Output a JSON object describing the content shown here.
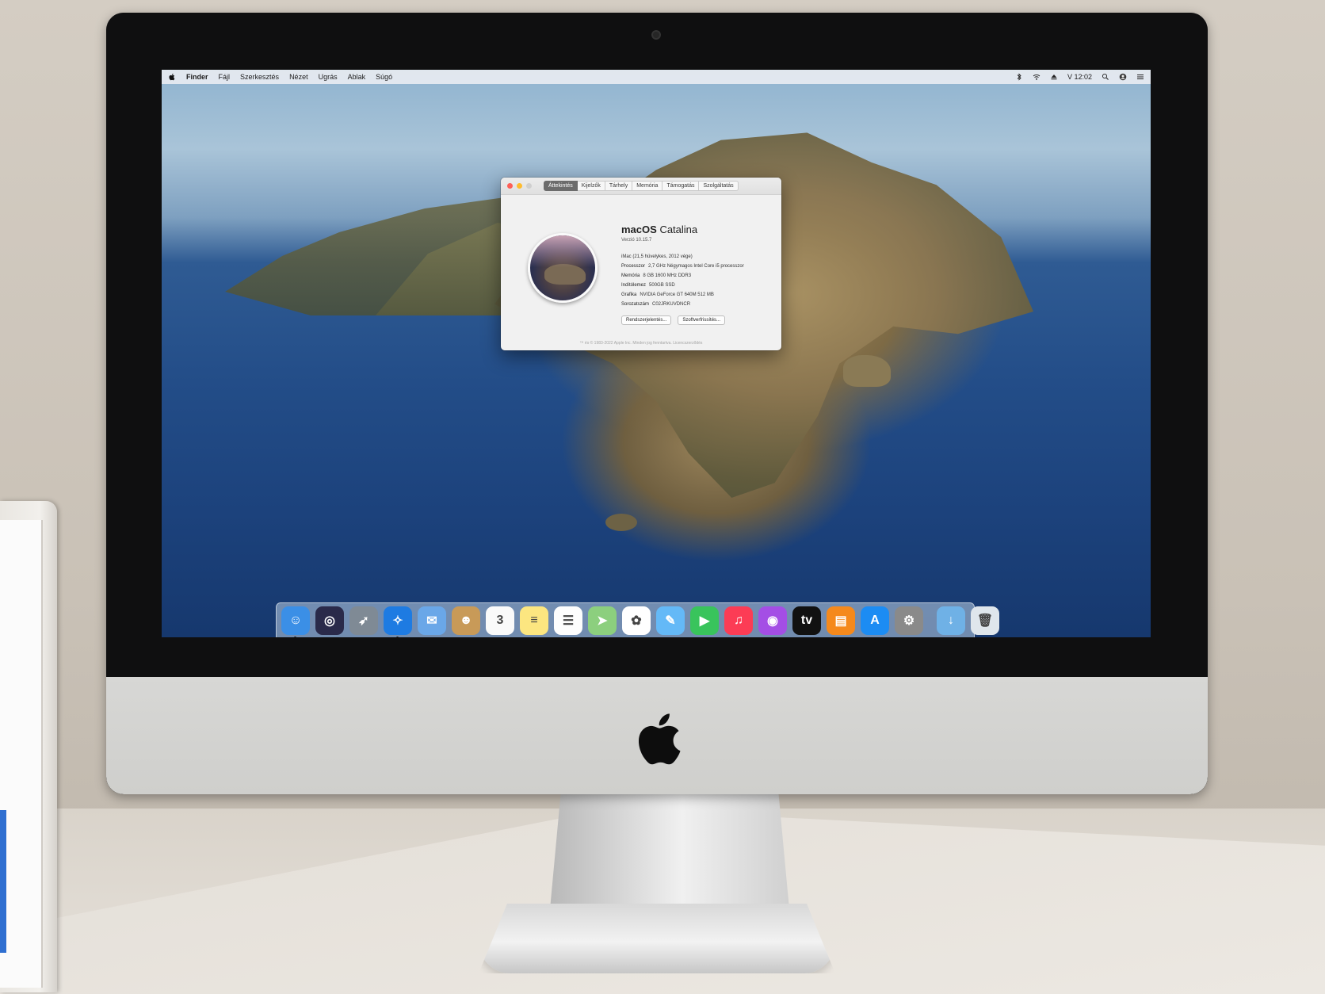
{
  "menubar": {
    "app_name": "Finder",
    "items": [
      "Fájl",
      "Szerkesztés",
      "Nézet",
      "Ugrás",
      "Ablak",
      "Súgó"
    ],
    "clock": "V 12:02",
    "icons": [
      "apple-icon",
      "bluetooth-icon",
      "wifi-icon",
      "eject-icon",
      "spotlight-search-icon",
      "user-icon",
      "notification-center-icon"
    ]
  },
  "about_window": {
    "tabs": [
      "Áttekintés",
      "Kijelzők",
      "Tárhely",
      "Memória",
      "Támogatás",
      "Szolgáltatás"
    ],
    "active_tab": "Áttekintés",
    "os_name_bold": "macOS",
    "os_name_light": "Catalina",
    "version": "Verzió 10.15.7",
    "model": "iMac (21,5 hüvelykes, 2012 vége)",
    "specs": [
      {
        "label": "Processzor",
        "value": "2,7 GHz Négymagos Intel Core i5 processzor"
      },
      {
        "label": "Memória",
        "value": "8 GB 1600 MHz DDR3"
      },
      {
        "label": "Indítólemez",
        "value": "500GB SSD"
      },
      {
        "label": "Grafika",
        "value": "NVIDIA GeForce GT 640M 512 MB"
      },
      {
        "label": "Sorozatszám",
        "value": "C02JRKUVDNCR"
      }
    ],
    "buttons": [
      "Rendszerjelentés...",
      "Szoftverfrissítés..."
    ],
    "footer": "™ és © 1983-2022 Apple Inc. Minden jog fenntartva. Licencszerződés"
  },
  "dock": {
    "apps": [
      {
        "name": "finder-icon",
        "color": "#3b8fe6",
        "glyph": "☺",
        "running": true
      },
      {
        "name": "siri-icon",
        "color": "#2a2a4a",
        "glyph": "◎",
        "running": false
      },
      {
        "name": "launchpad-icon",
        "color": "#7f8a95",
        "glyph": "➶",
        "running": false
      },
      {
        "name": "safari-icon",
        "color": "#1e7be2",
        "glyph": "✧",
        "running": true
      },
      {
        "name": "mail-icon",
        "color": "#6aa7e8",
        "glyph": "✉",
        "running": false
      },
      {
        "name": "contacts-icon",
        "color": "#c89a58",
        "glyph": "☻",
        "running": false
      },
      {
        "name": "calendar-icon",
        "color": "#fafafa",
        "glyph": "3",
        "running": false
      },
      {
        "name": "notes-icon",
        "color": "#fce680",
        "glyph": "≡",
        "running": false
      },
      {
        "name": "reminders-icon",
        "color": "#fdfdfd",
        "glyph": "☰",
        "running": false
      },
      {
        "name": "maps-icon",
        "color": "#8ccf7e",
        "glyph": "➤",
        "running": false
      },
      {
        "name": "photos-icon",
        "color": "#ffffff",
        "glyph": "✿",
        "running": false
      },
      {
        "name": "messages-icon",
        "color": "#64b9f7",
        "glyph": "✎",
        "running": false
      },
      {
        "name": "facetime-icon",
        "color": "#39c45c",
        "glyph": "▶",
        "running": false
      },
      {
        "name": "music-icon",
        "color": "#fc3c55",
        "glyph": "♫",
        "running": false
      },
      {
        "name": "podcasts-icon",
        "color": "#a44ee5",
        "glyph": "◉",
        "running": false
      },
      {
        "name": "tv-icon",
        "color": "#111111",
        "glyph": "tv",
        "running": false
      },
      {
        "name": "books-icon",
        "color": "#f5891c",
        "glyph": "▤",
        "running": false
      },
      {
        "name": "app-store-icon",
        "color": "#1c8cf3",
        "glyph": "A",
        "running": false
      },
      {
        "name": "system-preferences-icon",
        "color": "#8a8a8a",
        "glyph": "⚙",
        "running": false
      }
    ],
    "trailing": [
      {
        "name": "downloads-folder-icon",
        "color": "#6fb1e6",
        "glyph": "↓"
      },
      {
        "name": "trash-icon",
        "color": "#dfe6ec",
        "glyph": "🗑"
      }
    ]
  }
}
